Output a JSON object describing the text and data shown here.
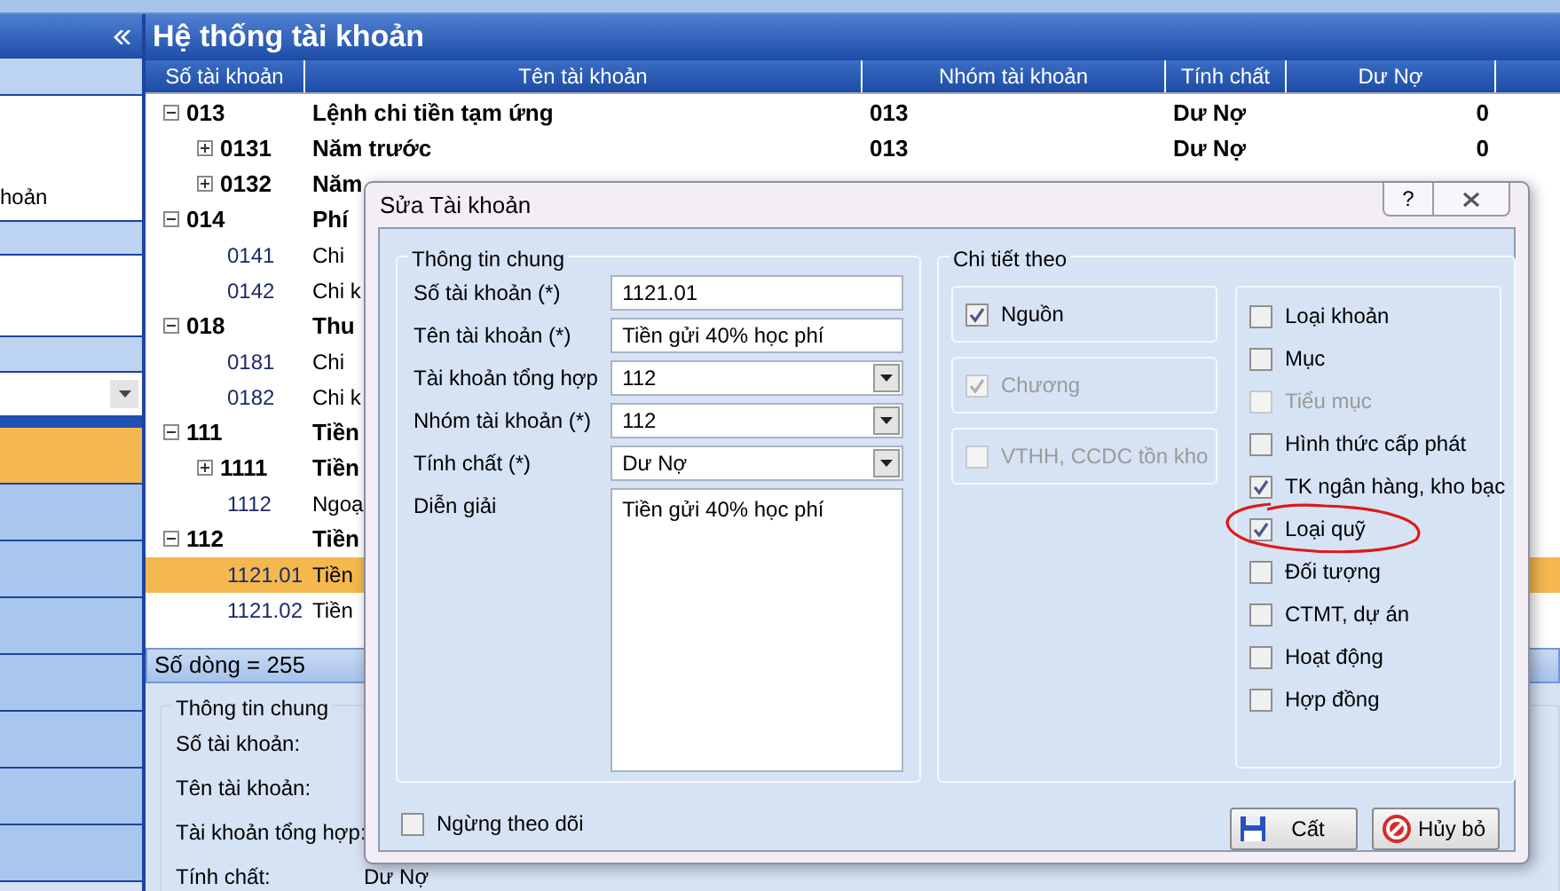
{
  "sidebar": {
    "cut_label": "hoản",
    "items": [
      {
        "selected": true
      },
      {
        "selected": false
      },
      {
        "selected": false
      },
      {
        "selected": false
      },
      {
        "selected": false
      },
      {
        "selected": false
      },
      {
        "selected": false
      },
      {
        "selected": false
      }
    ]
  },
  "main": {
    "title": "Hệ thống tài khoản",
    "columns": [
      "Số tài khoản",
      "Tên tài khoản",
      "Nhóm tài khoản",
      "Tính chất",
      "Dư Nợ"
    ],
    "rows": [
      {
        "kind": "group",
        "expanded": true,
        "number": "013",
        "name": "Lệnh chi tiền tạm ứng",
        "group": "013",
        "nature": "Dư Nợ",
        "debit": "0",
        "selected": false,
        "children": [
          {
            "kind": "group",
            "expanded": false,
            "number": "0131",
            "name": "Năm trước",
            "group": "013",
            "nature": "Dư Nợ",
            "debit": "0",
            "selected": false
          },
          {
            "kind": "group",
            "expanded": false,
            "number": "0132",
            "name": "Năm",
            "selected": false
          }
        ]
      },
      {
        "kind": "group",
        "expanded": true,
        "number": "014",
        "name": "Phí",
        "selected": false,
        "children": [
          {
            "kind": "leaf",
            "number": "0141",
            "name": "Chi",
            "selected": false
          },
          {
            "kind": "leaf",
            "number": "0142",
            "name": "Chi k",
            "selected": false
          }
        ]
      },
      {
        "kind": "group",
        "expanded": true,
        "number": "018",
        "name": "Thu",
        "selected": false,
        "children": [
          {
            "kind": "leaf",
            "number": "0181",
            "name": "Chi",
            "selected": false
          },
          {
            "kind": "leaf",
            "number": "0182",
            "name": "Chi k",
            "selected": false
          }
        ]
      },
      {
        "kind": "group",
        "expanded": true,
        "number": "111",
        "name": "Tiền",
        "selected": false,
        "children": [
          {
            "kind": "group",
            "expanded": false,
            "number": "1111",
            "name": "Tiền",
            "selected": false
          },
          {
            "kind": "leaf",
            "number": "1112",
            "name": "Ngoạ",
            "selected": false
          }
        ]
      },
      {
        "kind": "group",
        "expanded": true,
        "number": "112",
        "name": "Tiền",
        "selected": false,
        "children": [
          {
            "kind": "leaf",
            "number": "1121.01",
            "name": "Tiền",
            "selected": true
          },
          {
            "kind": "leaf",
            "number": "1121.02",
            "name": "Tiền",
            "selected": false
          }
        ]
      }
    ],
    "status": "Số dòng = 255",
    "details": {
      "legend": "Thông tin chung",
      "labels": [
        "Số tài khoản:",
        "Tên tài khoản:",
        "Tài khoản tổng hợp:",
        "Tính chất:"
      ],
      "nature_value": "Dư Nợ"
    }
  },
  "dialog": {
    "title": "Sửa Tài khoản",
    "help": "?",
    "general": {
      "legend": "Thông tin chung",
      "fields": [
        {
          "kind": "text",
          "label": "Số tài khoản (*)",
          "value": "1121.01"
        },
        {
          "kind": "text",
          "label": "Tên tài khoản (*)",
          "value": "Tiền gửi 40% học phí"
        },
        {
          "kind": "select",
          "label": "Tài khoản tổng hợp",
          "value": "112"
        },
        {
          "kind": "select",
          "label": "Nhóm tài khoản (*)",
          "value": "112"
        },
        {
          "kind": "select",
          "label": "Tính chất (*)",
          "value": "Dư Nợ"
        },
        {
          "kind": "textarea",
          "label": "Diễn giải",
          "value": "Tiền gửi 40% học phí"
        }
      ]
    },
    "stop_tracking": {
      "label": "Ngừng theo dõi",
      "checked": false
    },
    "detail": {
      "legend": "Chi tiết theo",
      "left": [
        {
          "label": "Nguồn",
          "checked": true,
          "disabled": false
        },
        {
          "label": "Chương",
          "checked": true,
          "disabled": true
        },
        {
          "label": "VTHH, CCDC tồn kho",
          "checked": false,
          "disabled": true
        }
      ],
      "right": [
        {
          "label": "Loại khoản",
          "checked": false,
          "disabled": false,
          "circled": false
        },
        {
          "label": "Mục",
          "checked": false,
          "disabled": false,
          "circled": false
        },
        {
          "label": "Tiểu mục",
          "checked": false,
          "disabled": true,
          "circled": false
        },
        {
          "label": "Hình thức cấp phát",
          "checked": false,
          "disabled": false,
          "circled": false
        },
        {
          "label": "TK ngân hàng, kho bạc",
          "checked": true,
          "disabled": false,
          "circled": false
        },
        {
          "label": "Loại quỹ",
          "checked": true,
          "disabled": false,
          "circled": true
        },
        {
          "label": "Đối tượng",
          "checked": false,
          "disabled": false,
          "circled": false
        },
        {
          "label": "CTMT, dự án",
          "checked": false,
          "disabled": false,
          "circled": false
        },
        {
          "label": "Hoạt động",
          "checked": false,
          "disabled": false,
          "circled": false
        },
        {
          "label": "Hợp đồng",
          "checked": false,
          "disabled": false,
          "circled": false
        }
      ]
    },
    "buttons": [
      {
        "kind": "save",
        "label": "Cất"
      },
      {
        "kind": "cancel",
        "label": "Hủy bỏ"
      }
    ]
  }
}
